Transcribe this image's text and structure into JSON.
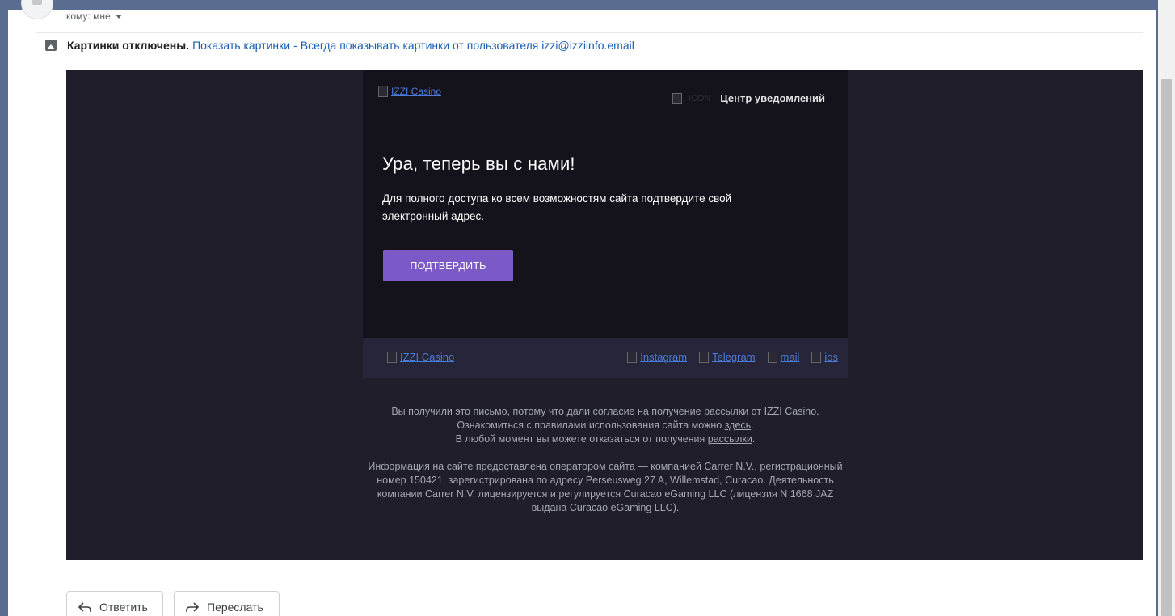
{
  "header": {
    "recipient_label": "кому: мне"
  },
  "images_bar": {
    "status": "Картинки отключены.",
    "show_link": "Показать картинки",
    "separator": "-",
    "always_show_link": "Всегда показывать картинки от пользователя izzi@izziinfo.email"
  },
  "email": {
    "logo_alt": "IZZI Casino",
    "icon_alt": "ICON",
    "notification_center": "Центр уведомлений",
    "headline": "Ура, теперь вы с нами!",
    "body": "Для полного доступа ко всем возможностям сайта подтвердите свой электронный адрес.",
    "confirm_button": "ПОДТВЕРДИТЬ",
    "footer_logo_alt": "IZZI Casino",
    "socials": [
      "Instagram",
      "Telegram",
      "mail",
      "ios"
    ],
    "legal": {
      "line1_prefix": "Вы получили это письмо, потому что дали согласие на получение рассылки от ",
      "line1_link": "IZZI Casino",
      "line1_suffix": ".",
      "line2_prefix": "Ознакомиться с правилами использования сайта можно ",
      "line2_link": "здесь",
      "line2_suffix": ".",
      "line3_prefix": "В любой момент вы можете отказаться от получения ",
      "line3_link": "рассылки",
      "line3_suffix": ".",
      "operator_info": "Информация на сайте предоставлена оператором сайта — компанией Carrer N.V., регистрационный номер 150421, зарегистрирована по адресу Perseusweg 27 A, Willemstad, Curacao. Деятельность компании Carrer N.V. лицензируется и регулируется Curacao eGaming LLC (лицензия N 1668 JAZ выдана Curacao eGaming LLC)."
    }
  },
  "actions": {
    "reply": "Ответить",
    "forward": "Переслать"
  }
}
